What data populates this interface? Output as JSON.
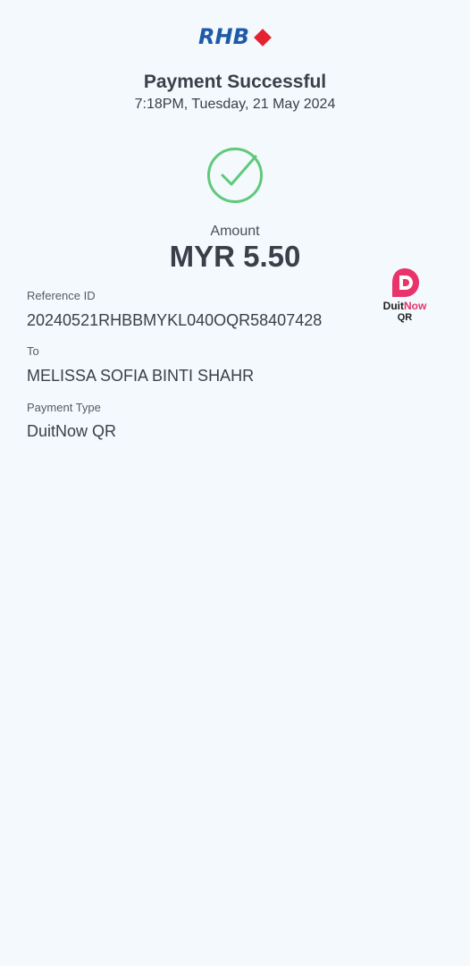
{
  "brand": {
    "logo_text": "RHB"
  },
  "header": {
    "title": "Payment Successful",
    "datetime": "7:18PM, Tuesday, 21 May 2024"
  },
  "amount": {
    "label": "Amount",
    "value": "MYR 5.50"
  },
  "duitnow": {
    "brand_part1": "Duit",
    "brand_part2": "Now",
    "sub": "QR"
  },
  "details": {
    "reference_label": "Reference ID",
    "reference_value": "20240521RHBBMYKL040OQR58407428",
    "to_label": "To",
    "to_value": "MELISSA SOFIA BINTI SHAHR",
    "payment_type_label": "Payment Type",
    "payment_type_value": "DuitNow QR"
  },
  "colors": {
    "background": "#f3f9fc",
    "brand_blue": "#1e5aa8",
    "brand_red": "#e52330",
    "success_green": "#5fc97a",
    "duitnow_pink": "#e8336b"
  },
  "icons": {
    "status": "check-circle-icon",
    "payment_method": "duitnow-logo"
  }
}
